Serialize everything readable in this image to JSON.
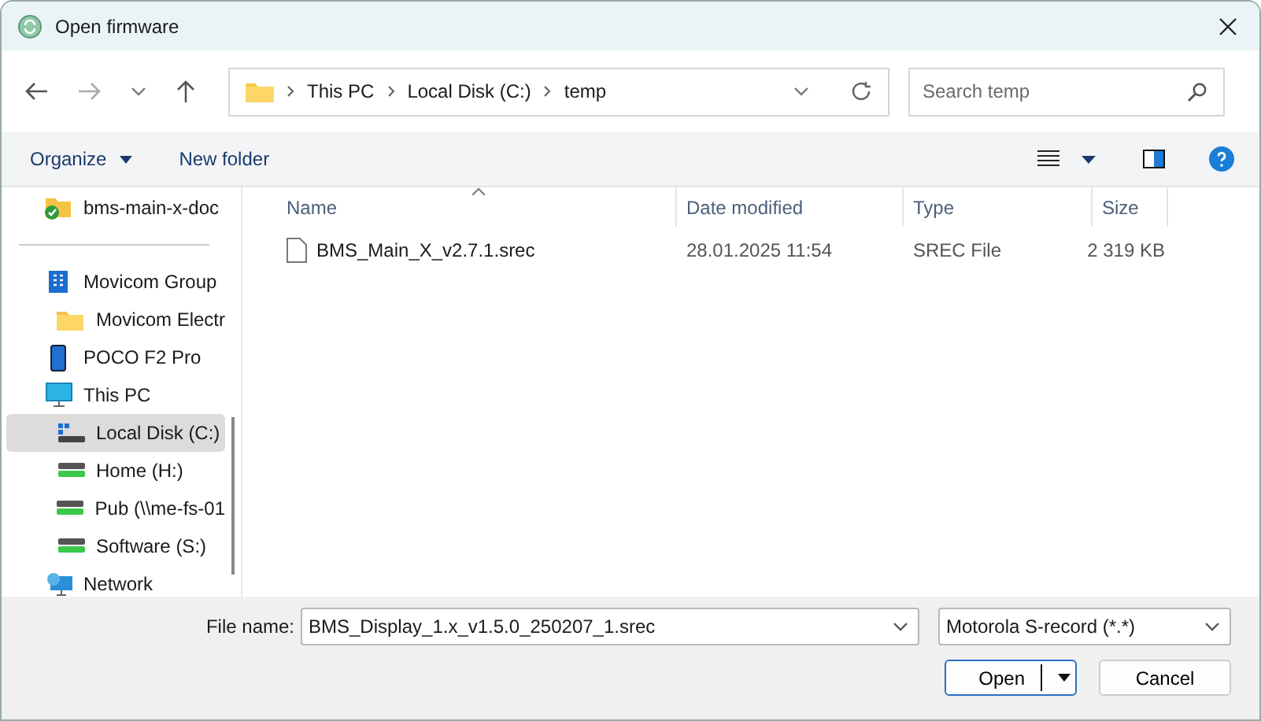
{
  "window": {
    "title": "Open firmware"
  },
  "address": {
    "segments": [
      "This PC",
      "Local Disk (C:)",
      "temp"
    ]
  },
  "search": {
    "placeholder": "Search temp"
  },
  "toolbar": {
    "organize": "Organize",
    "new_folder": "New folder"
  },
  "sidebar": {
    "items": [
      {
        "label": "bms-main-x-doc",
        "selected": false
      },
      {
        "label": "Movicom Group",
        "selected": false,
        "children": [
          {
            "label": "Movicom Electr",
            "selected": false
          }
        ]
      },
      {
        "label": "POCO F2 Pro",
        "selected": false
      },
      {
        "label": "This PC",
        "selected": false,
        "children": [
          {
            "label": "Local Disk (C:)",
            "selected": true
          },
          {
            "label": "Home (H:)",
            "selected": false
          },
          {
            "label": "Pub (\\\\me-fs-01",
            "selected": false
          },
          {
            "label": "Software (S:)",
            "selected": false
          }
        ]
      },
      {
        "label": "Network",
        "selected": false
      }
    ]
  },
  "table": {
    "columns": [
      "Name",
      "Date modified",
      "Type",
      "Size"
    ],
    "rows": [
      {
        "name": "BMS_Main_X_v2.7.1.srec",
        "date": "28.01.2025 11:54",
        "type": "SREC File",
        "size": "2 319 KB",
        "selected": false
      }
    ]
  },
  "footer": {
    "file_name_label": "File name:",
    "file_name": "BMS_Display_1.x_v1.5.0_250207_1.srec",
    "filter": "Motorola S-record (*.*)",
    "buttons": [
      "Open",
      "Cancel"
    ]
  }
}
